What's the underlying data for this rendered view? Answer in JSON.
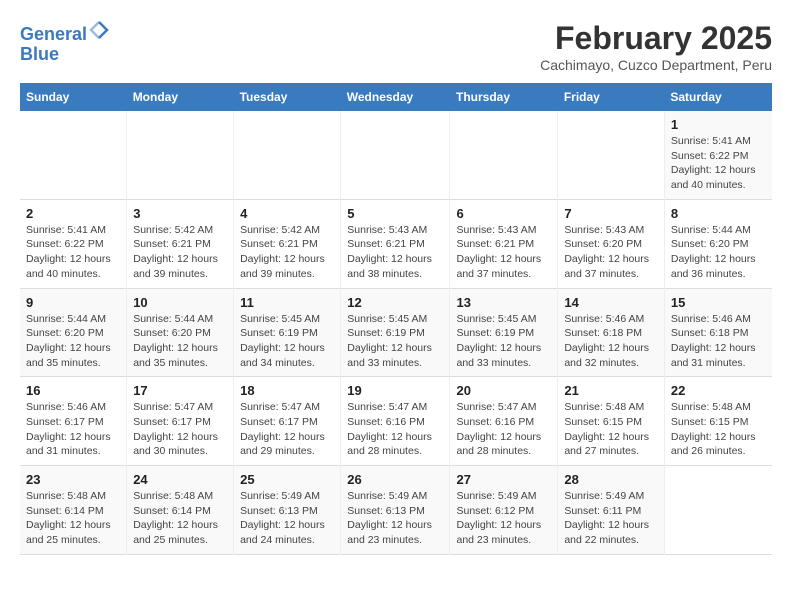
{
  "header": {
    "logo_line1": "General",
    "logo_line2": "Blue",
    "title": "February 2025",
    "subtitle": "Cachimayo, Cuzco Department, Peru"
  },
  "weekdays": [
    "Sunday",
    "Monday",
    "Tuesday",
    "Wednesday",
    "Thursday",
    "Friday",
    "Saturday"
  ],
  "weeks": [
    [
      {
        "day": "",
        "info": ""
      },
      {
        "day": "",
        "info": ""
      },
      {
        "day": "",
        "info": ""
      },
      {
        "day": "",
        "info": ""
      },
      {
        "day": "",
        "info": ""
      },
      {
        "day": "",
        "info": ""
      },
      {
        "day": "1",
        "info": "Sunrise: 5:41 AM\nSunset: 6:22 PM\nDaylight: 12 hours\nand 40 minutes."
      }
    ],
    [
      {
        "day": "2",
        "info": "Sunrise: 5:41 AM\nSunset: 6:22 PM\nDaylight: 12 hours\nand 40 minutes."
      },
      {
        "day": "3",
        "info": "Sunrise: 5:42 AM\nSunset: 6:21 PM\nDaylight: 12 hours\nand 39 minutes."
      },
      {
        "day": "4",
        "info": "Sunrise: 5:42 AM\nSunset: 6:21 PM\nDaylight: 12 hours\nand 39 minutes."
      },
      {
        "day": "5",
        "info": "Sunrise: 5:43 AM\nSunset: 6:21 PM\nDaylight: 12 hours\nand 38 minutes."
      },
      {
        "day": "6",
        "info": "Sunrise: 5:43 AM\nSunset: 6:21 PM\nDaylight: 12 hours\nand 37 minutes."
      },
      {
        "day": "7",
        "info": "Sunrise: 5:43 AM\nSunset: 6:20 PM\nDaylight: 12 hours\nand 37 minutes."
      },
      {
        "day": "8",
        "info": "Sunrise: 5:44 AM\nSunset: 6:20 PM\nDaylight: 12 hours\nand 36 minutes."
      }
    ],
    [
      {
        "day": "9",
        "info": "Sunrise: 5:44 AM\nSunset: 6:20 PM\nDaylight: 12 hours\nand 35 minutes."
      },
      {
        "day": "10",
        "info": "Sunrise: 5:44 AM\nSunset: 6:20 PM\nDaylight: 12 hours\nand 35 minutes."
      },
      {
        "day": "11",
        "info": "Sunrise: 5:45 AM\nSunset: 6:19 PM\nDaylight: 12 hours\nand 34 minutes."
      },
      {
        "day": "12",
        "info": "Sunrise: 5:45 AM\nSunset: 6:19 PM\nDaylight: 12 hours\nand 33 minutes."
      },
      {
        "day": "13",
        "info": "Sunrise: 5:45 AM\nSunset: 6:19 PM\nDaylight: 12 hours\nand 33 minutes."
      },
      {
        "day": "14",
        "info": "Sunrise: 5:46 AM\nSunset: 6:18 PM\nDaylight: 12 hours\nand 32 minutes."
      },
      {
        "day": "15",
        "info": "Sunrise: 5:46 AM\nSunset: 6:18 PM\nDaylight: 12 hours\nand 31 minutes."
      }
    ],
    [
      {
        "day": "16",
        "info": "Sunrise: 5:46 AM\nSunset: 6:17 PM\nDaylight: 12 hours\nand 31 minutes."
      },
      {
        "day": "17",
        "info": "Sunrise: 5:47 AM\nSunset: 6:17 PM\nDaylight: 12 hours\nand 30 minutes."
      },
      {
        "day": "18",
        "info": "Sunrise: 5:47 AM\nSunset: 6:17 PM\nDaylight: 12 hours\nand 29 minutes."
      },
      {
        "day": "19",
        "info": "Sunrise: 5:47 AM\nSunset: 6:16 PM\nDaylight: 12 hours\nand 28 minutes."
      },
      {
        "day": "20",
        "info": "Sunrise: 5:47 AM\nSunset: 6:16 PM\nDaylight: 12 hours\nand 28 minutes."
      },
      {
        "day": "21",
        "info": "Sunrise: 5:48 AM\nSunset: 6:15 PM\nDaylight: 12 hours\nand 27 minutes."
      },
      {
        "day": "22",
        "info": "Sunrise: 5:48 AM\nSunset: 6:15 PM\nDaylight: 12 hours\nand 26 minutes."
      }
    ],
    [
      {
        "day": "23",
        "info": "Sunrise: 5:48 AM\nSunset: 6:14 PM\nDaylight: 12 hours\nand 25 minutes."
      },
      {
        "day": "24",
        "info": "Sunrise: 5:48 AM\nSunset: 6:14 PM\nDaylight: 12 hours\nand 25 minutes."
      },
      {
        "day": "25",
        "info": "Sunrise: 5:49 AM\nSunset: 6:13 PM\nDaylight: 12 hours\nand 24 minutes."
      },
      {
        "day": "26",
        "info": "Sunrise: 5:49 AM\nSunset: 6:13 PM\nDaylight: 12 hours\nand 23 minutes."
      },
      {
        "day": "27",
        "info": "Sunrise: 5:49 AM\nSunset: 6:12 PM\nDaylight: 12 hours\nand 23 minutes."
      },
      {
        "day": "28",
        "info": "Sunrise: 5:49 AM\nSunset: 6:11 PM\nDaylight: 12 hours\nand 22 minutes."
      },
      {
        "day": "",
        "info": ""
      }
    ]
  ]
}
